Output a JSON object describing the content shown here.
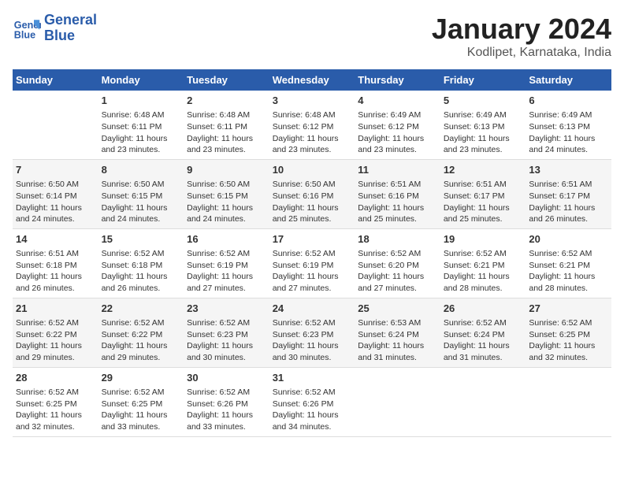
{
  "header": {
    "logo_line1": "General",
    "logo_line2": "Blue",
    "month": "January 2024",
    "location": "Kodlipet, Karnataka, India"
  },
  "days_of_week": [
    "Sunday",
    "Monday",
    "Tuesday",
    "Wednesday",
    "Thursday",
    "Friday",
    "Saturday"
  ],
  "weeks": [
    [
      {
        "day": "",
        "sunrise": "",
        "sunset": "",
        "daylight": ""
      },
      {
        "day": "1",
        "sunrise": "Sunrise: 6:48 AM",
        "sunset": "Sunset: 6:11 PM",
        "daylight": "Daylight: 11 hours and 23 minutes."
      },
      {
        "day": "2",
        "sunrise": "Sunrise: 6:48 AM",
        "sunset": "Sunset: 6:11 PM",
        "daylight": "Daylight: 11 hours and 23 minutes."
      },
      {
        "day": "3",
        "sunrise": "Sunrise: 6:48 AM",
        "sunset": "Sunset: 6:12 PM",
        "daylight": "Daylight: 11 hours and 23 minutes."
      },
      {
        "day": "4",
        "sunrise": "Sunrise: 6:49 AM",
        "sunset": "Sunset: 6:12 PM",
        "daylight": "Daylight: 11 hours and 23 minutes."
      },
      {
        "day": "5",
        "sunrise": "Sunrise: 6:49 AM",
        "sunset": "Sunset: 6:13 PM",
        "daylight": "Daylight: 11 hours and 23 minutes."
      },
      {
        "day": "6",
        "sunrise": "Sunrise: 6:49 AM",
        "sunset": "Sunset: 6:13 PM",
        "daylight": "Daylight: 11 hours and 24 minutes."
      }
    ],
    [
      {
        "day": "7",
        "sunrise": "Sunrise: 6:50 AM",
        "sunset": "Sunset: 6:14 PM",
        "daylight": "Daylight: 11 hours and 24 minutes."
      },
      {
        "day": "8",
        "sunrise": "Sunrise: 6:50 AM",
        "sunset": "Sunset: 6:15 PM",
        "daylight": "Daylight: 11 hours and 24 minutes."
      },
      {
        "day": "9",
        "sunrise": "Sunrise: 6:50 AM",
        "sunset": "Sunset: 6:15 PM",
        "daylight": "Daylight: 11 hours and 24 minutes."
      },
      {
        "day": "10",
        "sunrise": "Sunrise: 6:50 AM",
        "sunset": "Sunset: 6:16 PM",
        "daylight": "Daylight: 11 hours and 25 minutes."
      },
      {
        "day": "11",
        "sunrise": "Sunrise: 6:51 AM",
        "sunset": "Sunset: 6:16 PM",
        "daylight": "Daylight: 11 hours and 25 minutes."
      },
      {
        "day": "12",
        "sunrise": "Sunrise: 6:51 AM",
        "sunset": "Sunset: 6:17 PM",
        "daylight": "Daylight: 11 hours and 25 minutes."
      },
      {
        "day": "13",
        "sunrise": "Sunrise: 6:51 AM",
        "sunset": "Sunset: 6:17 PM",
        "daylight": "Daylight: 11 hours and 26 minutes."
      }
    ],
    [
      {
        "day": "14",
        "sunrise": "Sunrise: 6:51 AM",
        "sunset": "Sunset: 6:18 PM",
        "daylight": "Daylight: 11 hours and 26 minutes."
      },
      {
        "day": "15",
        "sunrise": "Sunrise: 6:52 AM",
        "sunset": "Sunset: 6:18 PM",
        "daylight": "Daylight: 11 hours and 26 minutes."
      },
      {
        "day": "16",
        "sunrise": "Sunrise: 6:52 AM",
        "sunset": "Sunset: 6:19 PM",
        "daylight": "Daylight: 11 hours and 27 minutes."
      },
      {
        "day": "17",
        "sunrise": "Sunrise: 6:52 AM",
        "sunset": "Sunset: 6:19 PM",
        "daylight": "Daylight: 11 hours and 27 minutes."
      },
      {
        "day": "18",
        "sunrise": "Sunrise: 6:52 AM",
        "sunset": "Sunset: 6:20 PM",
        "daylight": "Daylight: 11 hours and 27 minutes."
      },
      {
        "day": "19",
        "sunrise": "Sunrise: 6:52 AM",
        "sunset": "Sunset: 6:21 PM",
        "daylight": "Daylight: 11 hours and 28 minutes."
      },
      {
        "day": "20",
        "sunrise": "Sunrise: 6:52 AM",
        "sunset": "Sunset: 6:21 PM",
        "daylight": "Daylight: 11 hours and 28 minutes."
      }
    ],
    [
      {
        "day": "21",
        "sunrise": "Sunrise: 6:52 AM",
        "sunset": "Sunset: 6:22 PM",
        "daylight": "Daylight: 11 hours and 29 minutes."
      },
      {
        "day": "22",
        "sunrise": "Sunrise: 6:52 AM",
        "sunset": "Sunset: 6:22 PM",
        "daylight": "Daylight: 11 hours and 29 minutes."
      },
      {
        "day": "23",
        "sunrise": "Sunrise: 6:52 AM",
        "sunset": "Sunset: 6:23 PM",
        "daylight": "Daylight: 11 hours and 30 minutes."
      },
      {
        "day": "24",
        "sunrise": "Sunrise: 6:52 AM",
        "sunset": "Sunset: 6:23 PM",
        "daylight": "Daylight: 11 hours and 30 minutes."
      },
      {
        "day": "25",
        "sunrise": "Sunrise: 6:53 AM",
        "sunset": "Sunset: 6:24 PM",
        "daylight": "Daylight: 11 hours and 31 minutes."
      },
      {
        "day": "26",
        "sunrise": "Sunrise: 6:52 AM",
        "sunset": "Sunset: 6:24 PM",
        "daylight": "Daylight: 11 hours and 31 minutes."
      },
      {
        "day": "27",
        "sunrise": "Sunrise: 6:52 AM",
        "sunset": "Sunset: 6:25 PM",
        "daylight": "Daylight: 11 hours and 32 minutes."
      }
    ],
    [
      {
        "day": "28",
        "sunrise": "Sunrise: 6:52 AM",
        "sunset": "Sunset: 6:25 PM",
        "daylight": "Daylight: 11 hours and 32 minutes."
      },
      {
        "day": "29",
        "sunrise": "Sunrise: 6:52 AM",
        "sunset": "Sunset: 6:25 PM",
        "daylight": "Daylight: 11 hours and 33 minutes."
      },
      {
        "day": "30",
        "sunrise": "Sunrise: 6:52 AM",
        "sunset": "Sunset: 6:26 PM",
        "daylight": "Daylight: 11 hours and 33 minutes."
      },
      {
        "day": "31",
        "sunrise": "Sunrise: 6:52 AM",
        "sunset": "Sunset: 6:26 PM",
        "daylight": "Daylight: 11 hours and 34 minutes."
      },
      {
        "day": "",
        "sunrise": "",
        "sunset": "",
        "daylight": ""
      },
      {
        "day": "",
        "sunrise": "",
        "sunset": "",
        "daylight": ""
      },
      {
        "day": "",
        "sunrise": "",
        "sunset": "",
        "daylight": ""
      }
    ]
  ]
}
